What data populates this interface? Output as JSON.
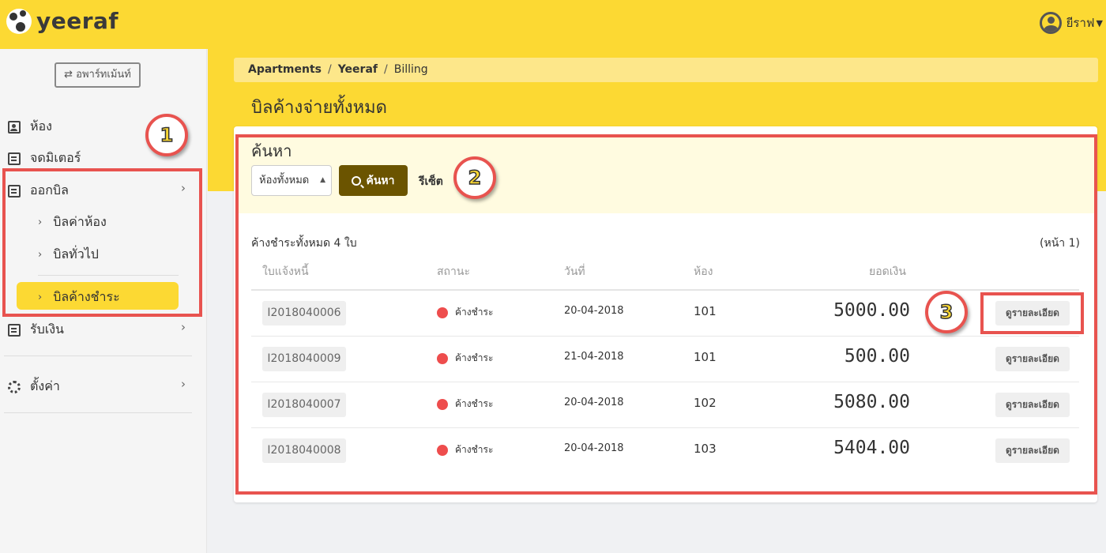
{
  "app": {
    "logo_text": "yeeraf",
    "user_name": "ยีราฟ",
    "brand_color": "#fcd933"
  },
  "sidebar": {
    "apartment_button": "⇄ อพาร์ทเม้นท์",
    "items": [
      {
        "label": "ห้อง",
        "icon": "contact-icon"
      },
      {
        "label": "จดมิเตอร์",
        "icon": "meter-doc-icon"
      },
      {
        "label": "ออกบิล",
        "icon": "document-icon"
      },
      {
        "label": "รับเงิน",
        "icon": "document-icon"
      },
      {
        "label": "ตั้งค่า",
        "icon": "gear-icon"
      }
    ],
    "sub_items": [
      {
        "label": "บิลค่าห้อง"
      },
      {
        "label": "บิลทั่วไป"
      },
      {
        "label": "บิลค้างชำระ",
        "active": true
      }
    ]
  },
  "breadcrumb": {
    "items": [
      "Apartments",
      "Yeeraf",
      "Billing"
    ],
    "separator": "/"
  },
  "page": {
    "title": "บิลค้างจ่ายทั้งหมด"
  },
  "search": {
    "title": "ค้นหา",
    "room_select_value": "ห้องทั้งหมด",
    "search_button": "ค้นหา",
    "reset_link": "รีเซ็ต"
  },
  "results": {
    "summary": "ค้างชำระทั้งหมด 4 ใบ",
    "page_label": "(หน้า 1)",
    "columns": [
      "ใบแจ้งหนี้",
      "สถานะ",
      "วันที่",
      "ห้อง",
      "ยอดเงิน"
    ],
    "rows": [
      {
        "invoice": "I2018040006",
        "status": "ค้างชำระ",
        "date": "20-04-2018",
        "room": "101",
        "amount": "5000.00",
        "action": "ดูรายละเอียด"
      },
      {
        "invoice": "I2018040009",
        "status": "ค้างชำระ",
        "date": "21-04-2018",
        "room": "101",
        "amount": "500.00",
        "action": "ดูรายละเอียด"
      },
      {
        "invoice": "I2018040007",
        "status": "ค้างชำระ",
        "date": "20-04-2018",
        "room": "102",
        "amount": "5080.00",
        "action": "ดูรายละเอียด"
      },
      {
        "invoice": "I2018040008",
        "status": "ค้างชำระ",
        "date": "20-04-2018",
        "room": "103",
        "amount": "5404.00",
        "action": "ดูรายละเอียด"
      }
    ],
    "status_color": "#ee4d4d"
  },
  "annotations": {
    "markers": [
      "1",
      "2",
      "3"
    ],
    "color": "#e8534f"
  }
}
